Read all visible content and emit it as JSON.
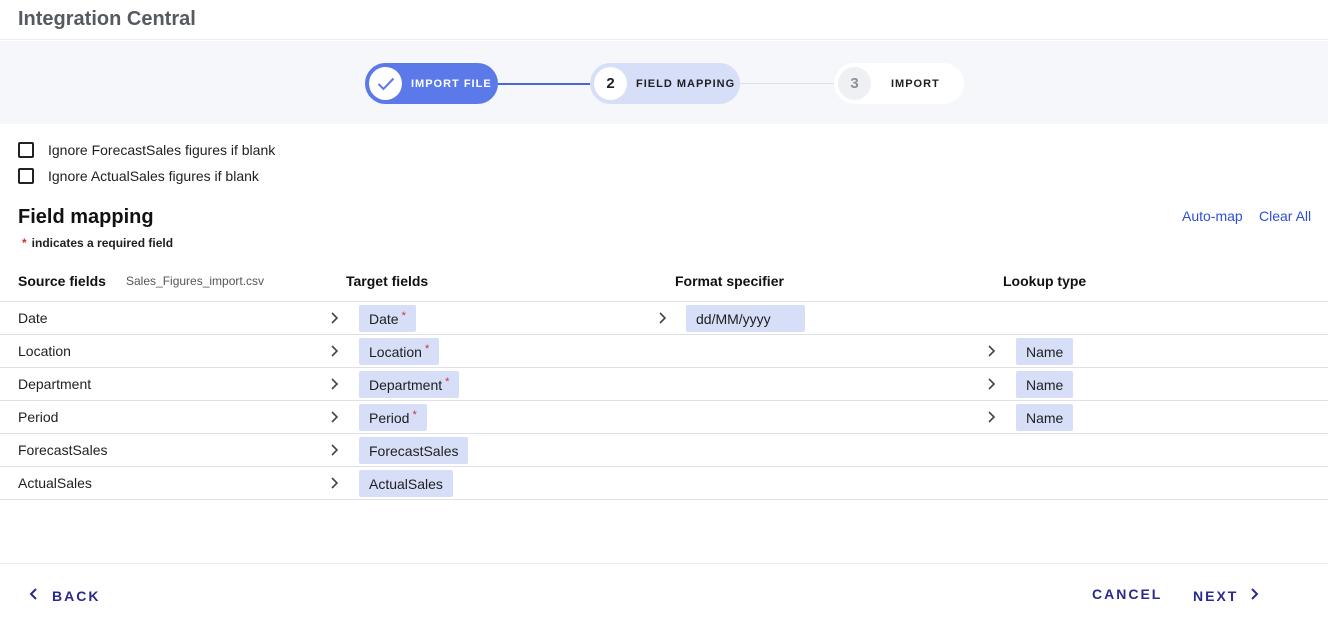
{
  "app": {
    "title": "Integration Central"
  },
  "stepper": {
    "steps": [
      {
        "number": "",
        "label": "IMPORT FILE",
        "state": "complete"
      },
      {
        "number": "2",
        "label": "FIELD MAPPING",
        "state": "active"
      },
      {
        "number": "3",
        "label": "IMPORT",
        "state": "pending"
      }
    ]
  },
  "options": [
    {
      "label": "Ignore ForecastSales figures if blank",
      "checked": false
    },
    {
      "label": "Ignore ActualSales figures if blank",
      "checked": false
    }
  ],
  "mapping": {
    "title": "Field mapping",
    "required_star": "*",
    "required_note": "indicates a required field",
    "automap_label": "Auto-map",
    "clear_all_label": "Clear All",
    "columns": {
      "source": "Source fields",
      "file_name": "Sales_Figures_import.csv",
      "target": "Target fields",
      "format": "Format specifier",
      "lookup": "Lookup type"
    },
    "rows": [
      {
        "source": "Date",
        "target": "Date",
        "required": "*",
        "format": "dd/MM/yyyy",
        "lookup": ""
      },
      {
        "source": "Location",
        "target": "Location",
        "required": "*",
        "format": "",
        "lookup": "Name"
      },
      {
        "source": "Department",
        "target": "Department",
        "required": "*",
        "format": "",
        "lookup": "Name"
      },
      {
        "source": "Period",
        "target": "Period",
        "required": "*",
        "format": "",
        "lookup": "Name"
      },
      {
        "source": "ForecastSales",
        "target": "ForecastSales",
        "required": "",
        "format": "",
        "lookup": ""
      },
      {
        "source": "ActualSales",
        "target": "ActualSales",
        "required": "",
        "format": "",
        "lookup": ""
      }
    ]
  },
  "footer": {
    "back_label": "BACK",
    "cancel_label": "CANCEL",
    "next_label": "NEXT"
  },
  "colors": {
    "accent": "#5b79e9",
    "chip": "#d6def8",
    "link": "#2f4fd6",
    "footer_text": "#2a2a8c",
    "required": "#d0303a"
  }
}
